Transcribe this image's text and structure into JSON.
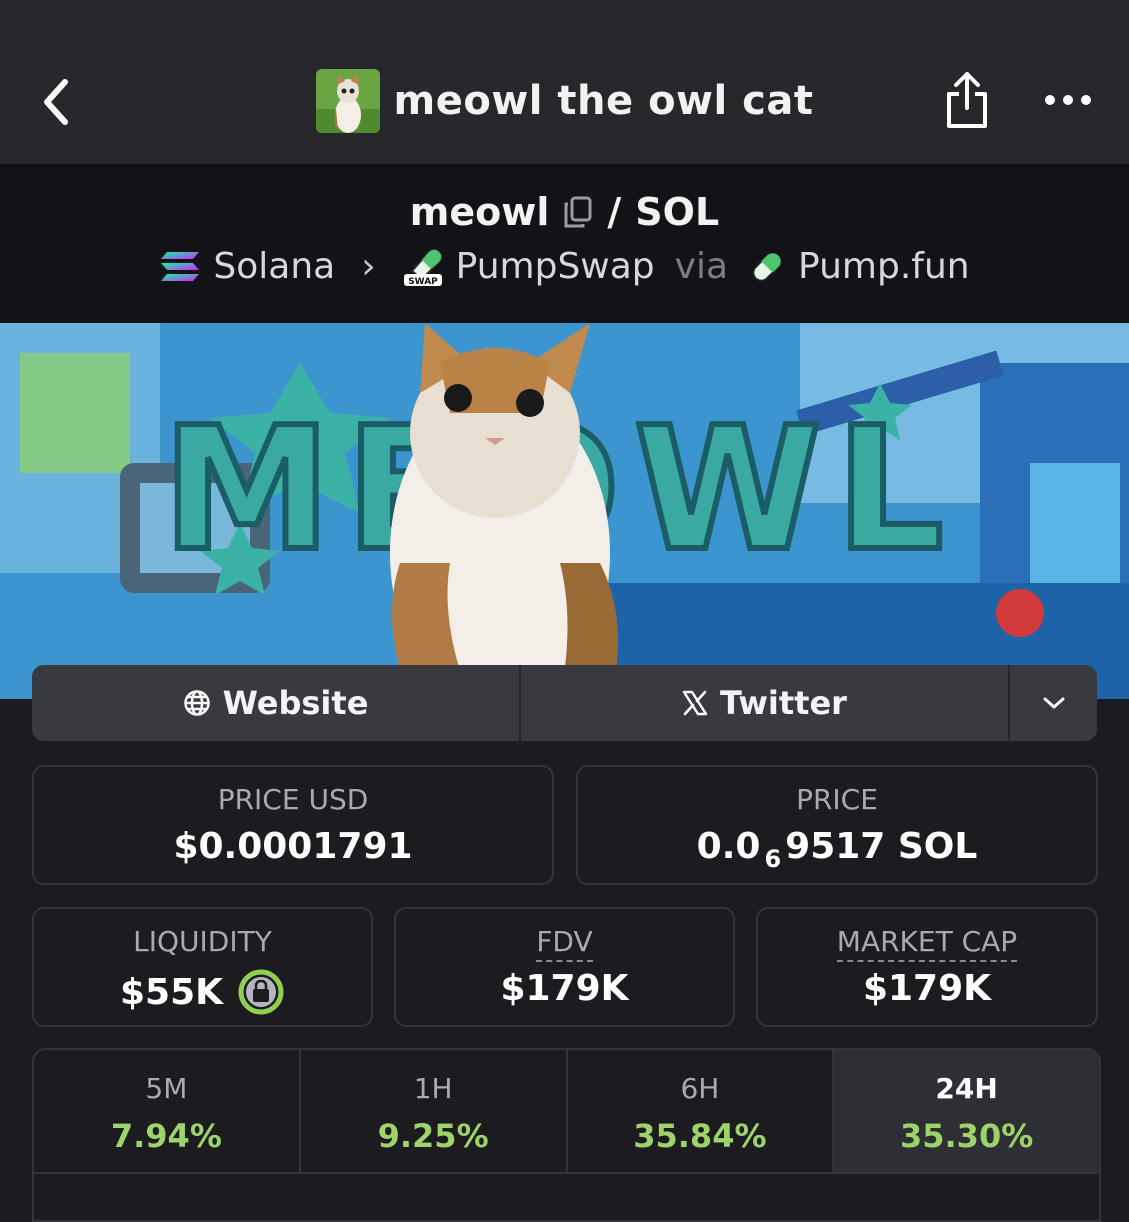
{
  "header": {
    "title": "meowl the owl cat",
    "icons": {
      "back": "chevron-left-icon",
      "share": "share-icon",
      "more": "more-horizontal-icon"
    }
  },
  "pair": {
    "base": "meowl",
    "separator": "/",
    "quote": "SOL",
    "chain": "Solana",
    "dex": "PumpSwap",
    "dex_badge": "SWAP",
    "via_label": "via",
    "launchpad": "Pump.fun"
  },
  "banner": {
    "text": "MEOWL"
  },
  "links": {
    "website": "Website",
    "twitter": "Twitter"
  },
  "stats": {
    "price_usd": {
      "label": "PRICE USD",
      "value": "$0.0001791"
    },
    "price": {
      "label": "PRICE",
      "value_prefix": "0.0",
      "value_sub": "6",
      "value_suffix": "9517 SOL"
    },
    "liquidity": {
      "label": "LIQUIDITY",
      "value": "$55K"
    },
    "fdv": {
      "label": "FDV",
      "value": "$179K"
    },
    "market_cap": {
      "label": "MARKET CAP",
      "value": "$179K"
    }
  },
  "changes": [
    {
      "label": "5M",
      "value": "7.94%"
    },
    {
      "label": "1H",
      "value": "9.25%"
    },
    {
      "label": "6H",
      "value": "35.84%"
    },
    {
      "label": "24H",
      "value": "35.30%"
    }
  ],
  "active_change": "24H",
  "colors": {
    "positive": "#9ed36a",
    "lock_ring": "#8fd14f",
    "background": "#1b1b20"
  }
}
